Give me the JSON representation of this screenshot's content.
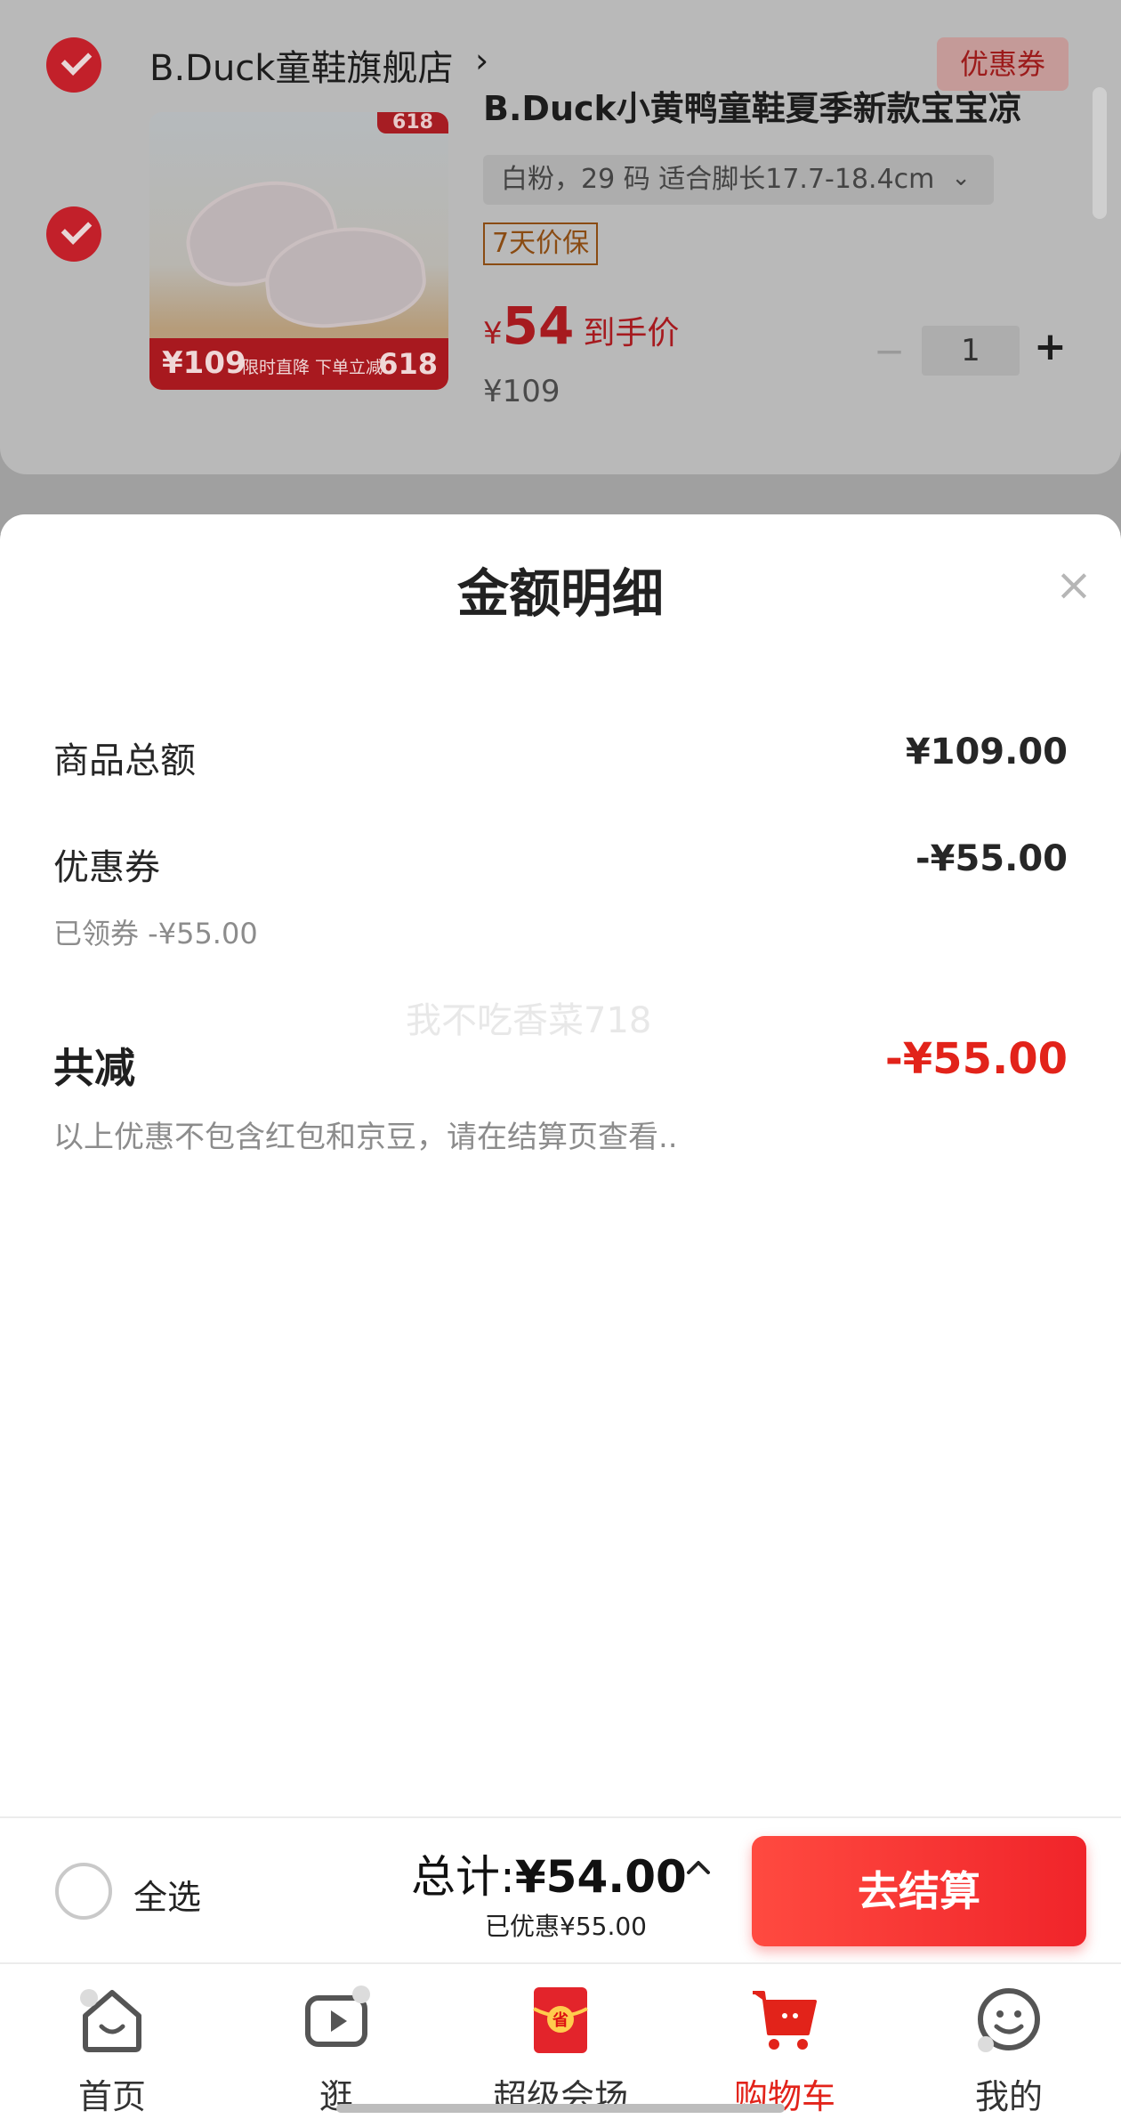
{
  "store": {
    "name": "B.Duck童鞋旗舰店",
    "arrow": "›",
    "coupon_tag": "优惠券"
  },
  "product": {
    "title": "B.Duck小黄鸭童鞋夏季新款宝宝凉",
    "spec": "白粉，29 码 适合脚长17.7-18.4cm",
    "spec_chevron": "⌄",
    "guarantee": "7天价保",
    "price_symbol": "¥",
    "price_now": "54",
    "price_tag": "到手价",
    "price_orig": "¥109",
    "quantity": "1",
    "minus": "−",
    "plus": "+",
    "thumb_badge": "618",
    "thumb_price": "¥109",
    "thumb_promo": "限时直降 下单立减",
    "thumb_618": "618"
  },
  "sheet": {
    "title": "金额明细",
    "close": "×",
    "goods_total_label": "商品总额",
    "goods_total_value": "¥109.00",
    "coupon_label": "优惠券",
    "coupon_value": "-¥55.00",
    "coupon_note": "已领券 -¥55.00",
    "watermark": "我不吃香菜718",
    "total_reduce_label": "共减",
    "total_reduce_value": "-¥55.00",
    "footnote": "以上优惠不包含红包和京豆，请在结算页查看.."
  },
  "checkout": {
    "select_all": "全选",
    "total_label": "总计:",
    "total_value": "¥54.00",
    "saved": "已优惠¥55.00",
    "pay_button": "去结算"
  },
  "tabs": [
    {
      "label": "首页",
      "icon": "home-icon"
    },
    {
      "label": "逛",
      "icon": "video-play-icon"
    },
    {
      "label": "超级会场",
      "icon": "red-envelope-icon"
    },
    {
      "label": "购物车",
      "icon": "cart-icon"
    },
    {
      "label": "我的",
      "icon": "smiley-icon"
    }
  ],
  "colors": {
    "accent": "#e2231a",
    "pay_button": "#f0242a"
  }
}
